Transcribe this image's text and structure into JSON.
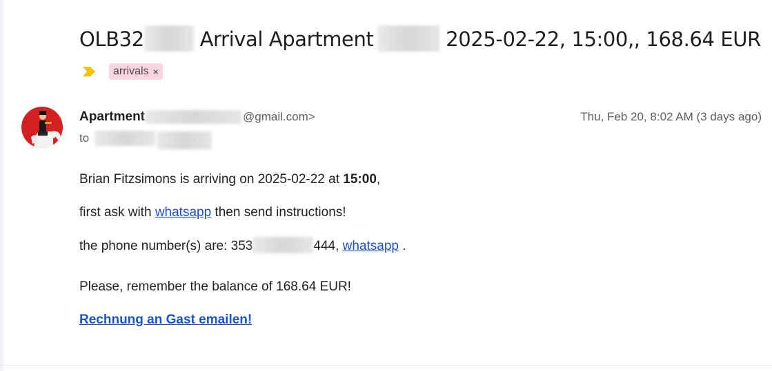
{
  "subject": {
    "part1": "OLB32",
    "part2": "Arrival Apartment",
    "part3": "2025-02-22, 15:00,, 168.64 EUR"
  },
  "labels": [
    {
      "name": "arrivals",
      "color": "#f9d3de",
      "remove_glyph": "×"
    }
  ],
  "importance_marker": {
    "icon": "importance-icon",
    "color": "#f4c20d"
  },
  "sender": {
    "name": "Apartment",
    "email_suffix": "@gmail.com>",
    "avatar_icon": "avatar-rider-on-horse"
  },
  "date": "Thu, Feb 20, 8:02 AM (3 days ago)",
  "recipient_prefix": "to",
  "body": {
    "line1_before": "Brian Fitzsimons is arriving on 2025-02-22 at ",
    "line1_bold": "15:00",
    "line1_after": ",",
    "line2_before": "first ask with ",
    "line2_link": "whatsapp",
    "line2_after": " then send instructions!",
    "line3_before": "the phone number(s) are: 353",
    "line3_mid": "444, ",
    "line3_link": "whatsapp",
    "line3_after": " .",
    "line4": "Please, remember the balance of 168.64 EUR!",
    "invoice_link": "Rechnung an Gast emailen!"
  },
  "colors": {
    "link": "#1a4fc4",
    "label_bg": "#f9d3de",
    "avatar_bg": "#d42020"
  }
}
